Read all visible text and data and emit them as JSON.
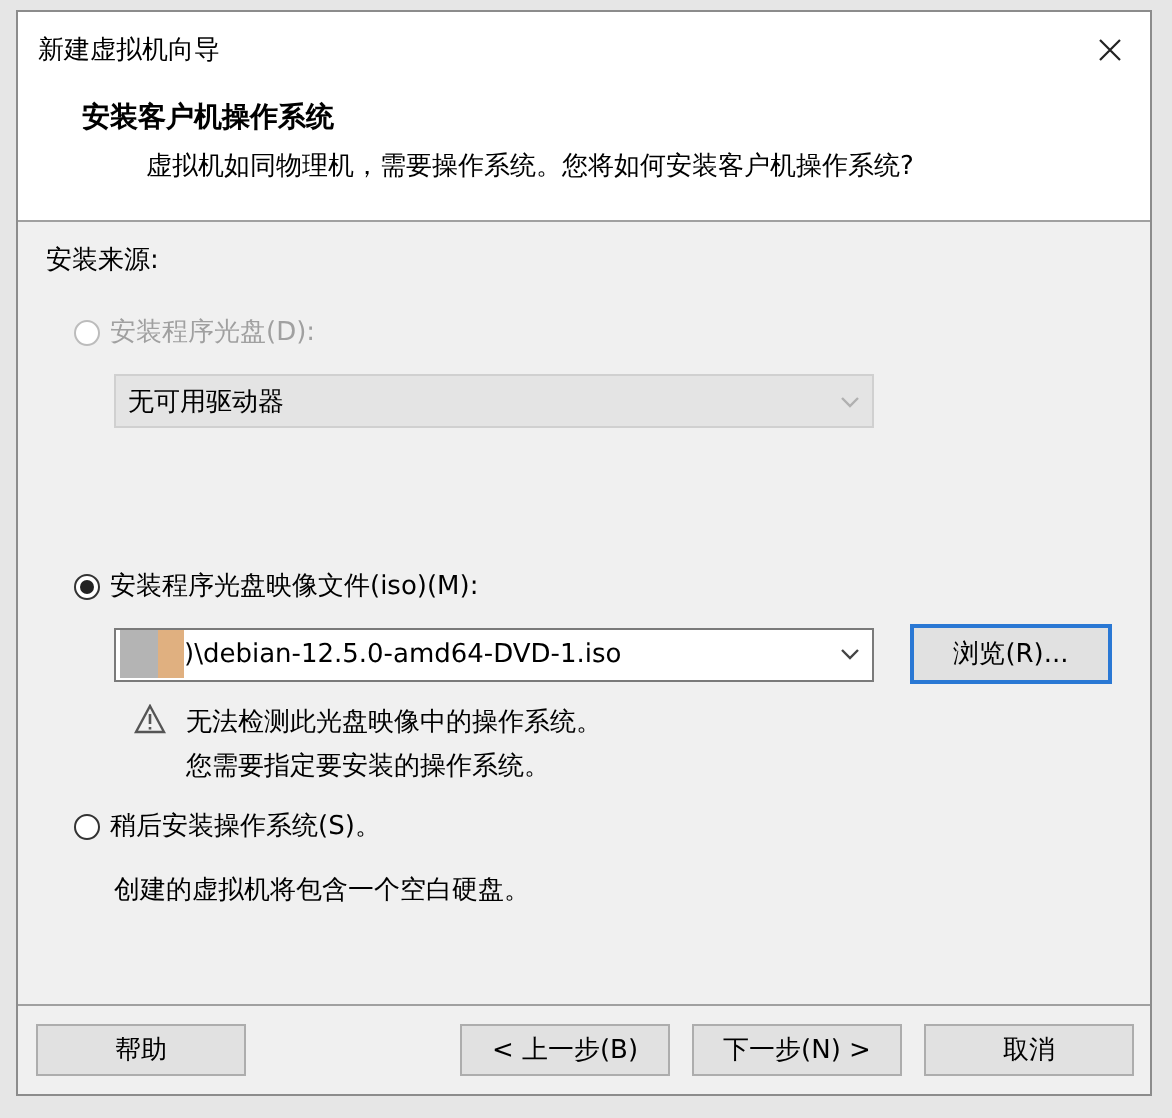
{
  "window": {
    "title": "新建虚拟机向导"
  },
  "header": {
    "title": "安装客户机操作系统",
    "subtitle": "虚拟机如同物理机，需要操作系统。您将如何安装客户机操作系统?"
  },
  "source_label": "安装来源:",
  "options": [
    {
      "kind": "disc",
      "label": "安装程序光盘(D):",
      "selected": false,
      "disabled": true,
      "drive": "无可用驱动器"
    },
    {
      "kind": "iso",
      "label": "安装程序光盘映像文件(iso)(M):",
      "selected": true,
      "disabled": false,
      "path": ")\\debian-12.5.0-amd64-DVD-1.iso",
      "browse_button": "浏览(R)...",
      "warning": [
        "无法检测此光盘映像中的操作系统。",
        "您需要指定要安装的操作系统。"
      ]
    },
    {
      "kind": "later",
      "label": "稍后安装操作系统(S)。",
      "selected": false,
      "disabled": false,
      "note": "创建的虚拟机将包含一个空白硬盘。"
    }
  ],
  "buttons": {
    "help": "帮助",
    "nav": [
      "< 上一步(B)",
      "下一步(N) >",
      "取消"
    ]
  }
}
